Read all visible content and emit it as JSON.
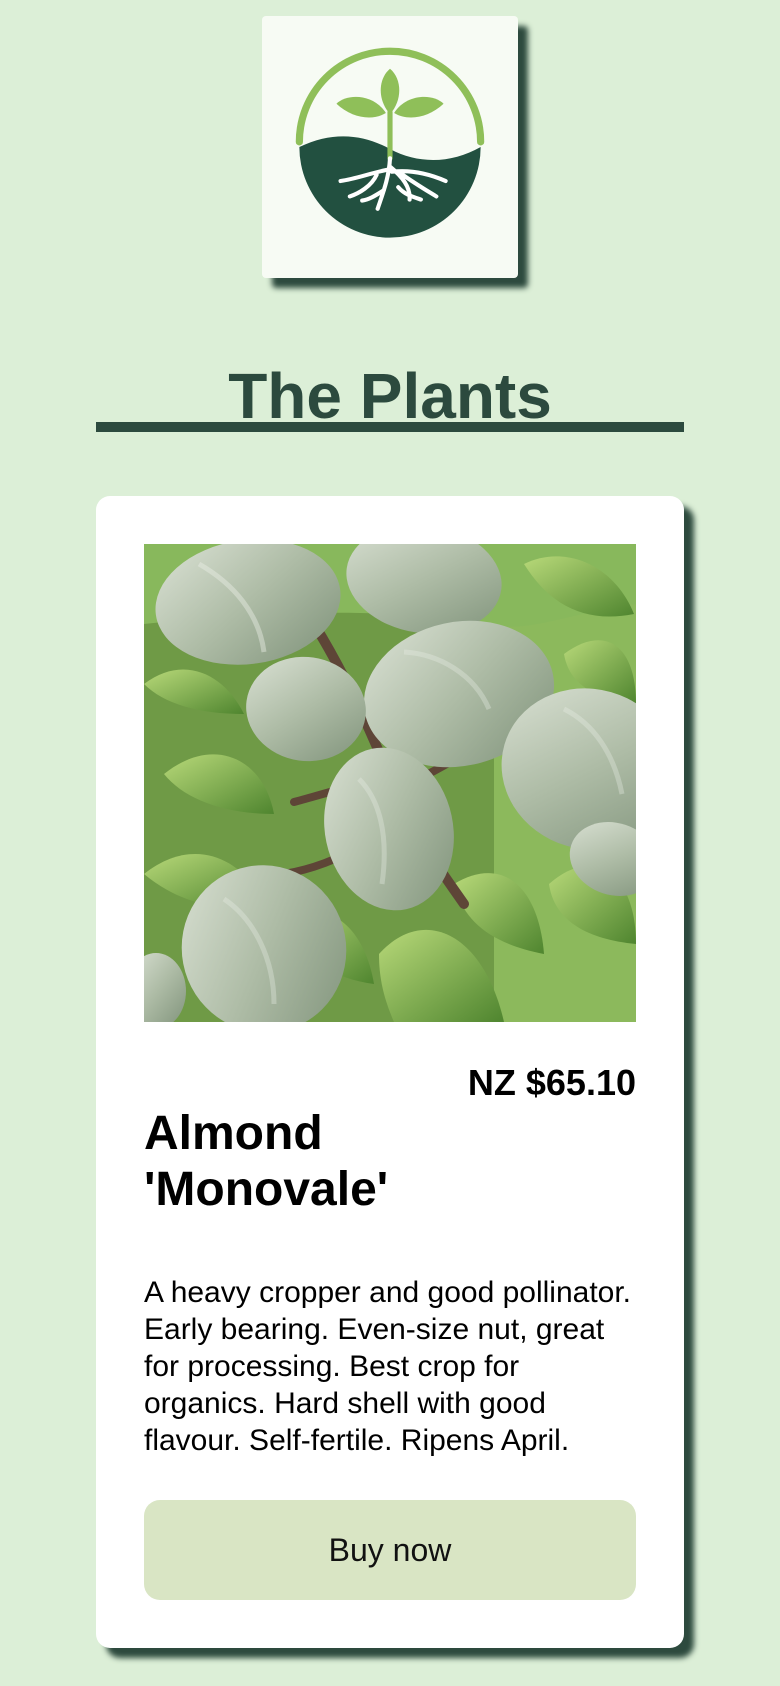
{
  "brand": {
    "title": "The Plants",
    "logo_icon": "plant-roots-logo-icon"
  },
  "product": {
    "image_subject": "almond-fruit-image",
    "name": "Almond 'Monovale'",
    "price": "NZ $65.10",
    "description": "A heavy cropper and good pollinator. Early bearing. Even-size nut, great for processing. Best crop for organics. Hard shell with good flavour. Self-fertile. Ripens April.",
    "buy_label": "Buy now"
  },
  "colors": {
    "page_background": "#dcefd7",
    "brand_dark_green": "#2c4a3e",
    "logo_green": "#8fbf59",
    "card_background": "#ffffff",
    "button_background": "#d9e5c4"
  }
}
